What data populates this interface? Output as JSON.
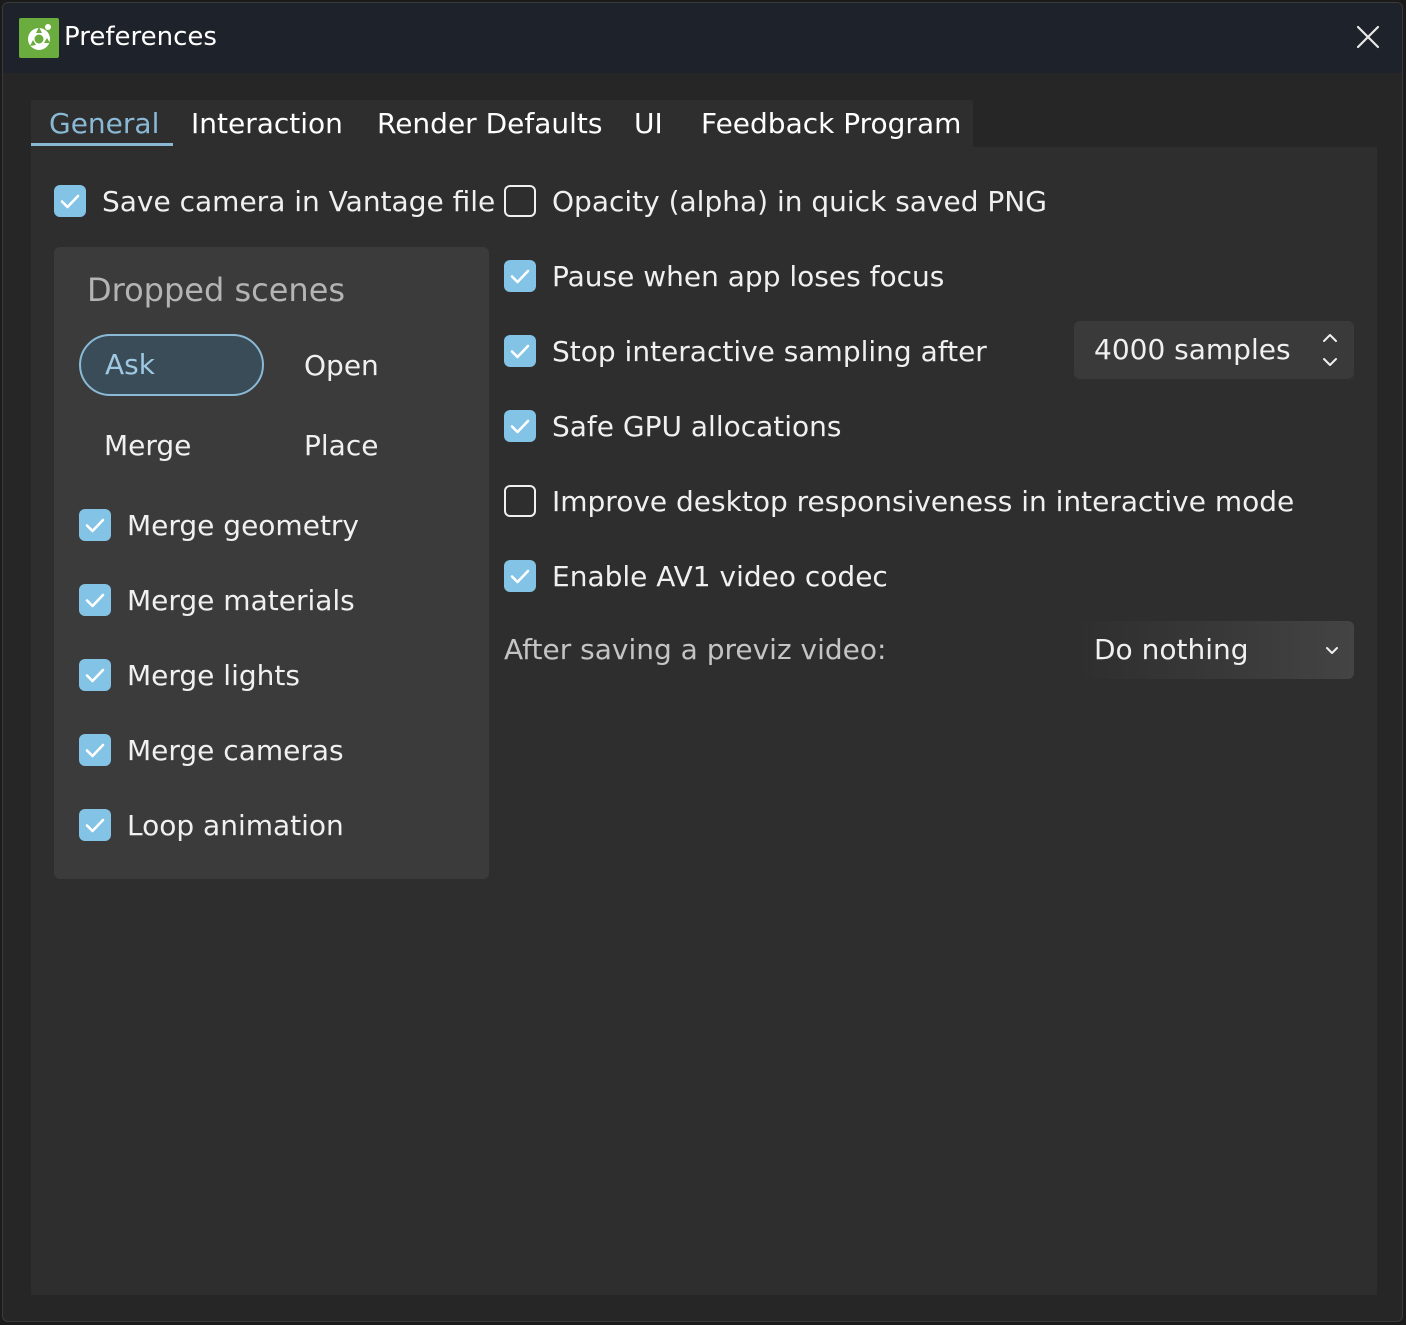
{
  "window": {
    "title": "Preferences"
  },
  "tabs": [
    {
      "label": "General",
      "active": true
    },
    {
      "label": "Interaction",
      "active": false
    },
    {
      "label": "Render Defaults",
      "active": false
    },
    {
      "label": "UI",
      "active": false
    },
    {
      "label": "Feedback Program",
      "active": false
    }
  ],
  "general": {
    "save_camera": {
      "label": "Save camera in Vantage file",
      "checked": true
    },
    "dropped_scenes": {
      "title": "Dropped scenes",
      "options": [
        "Ask",
        "Open",
        "Merge",
        "Place"
      ],
      "selected": "Ask",
      "checks": [
        {
          "label": "Merge geometry",
          "checked": true
        },
        {
          "label": "Merge materials",
          "checked": true
        },
        {
          "label": "Merge lights",
          "checked": true
        },
        {
          "label": "Merge cameras",
          "checked": true
        },
        {
          "label": "Loop animation",
          "checked": true
        }
      ]
    },
    "right": [
      {
        "label": "Opacity (alpha) in quick saved PNG",
        "checked": false
      },
      {
        "label": "Pause when app loses focus",
        "checked": true
      },
      {
        "label": "Stop interactive sampling after",
        "checked": true
      },
      {
        "label": "Safe GPU allocations",
        "checked": true
      },
      {
        "label": "Improve desktop responsiveness in interactive mode",
        "checked": false
      },
      {
        "label": "Enable AV1 video codec",
        "checked": true
      }
    ],
    "samples_value": "4000 samples",
    "previz_label": "After saving a previz video:",
    "previz_value": "Do nothing"
  },
  "colors": {
    "accent": "#8ab9d6",
    "checkbox_on": "#83c3e6",
    "app_icon": "#6aac3e"
  },
  "icons": {
    "app": "vantage-logo-icon",
    "close": "close-icon",
    "check": "check-icon",
    "spinner": "chevron-up-down-icon",
    "dropdown": "chevron-down-icon"
  }
}
